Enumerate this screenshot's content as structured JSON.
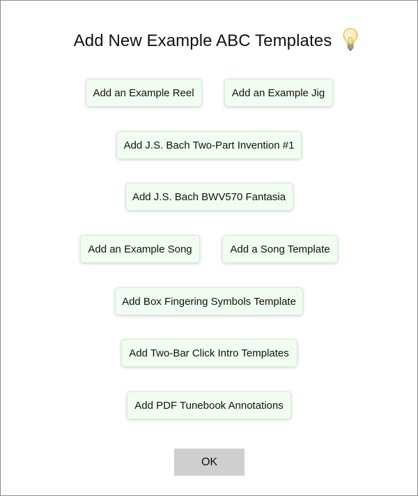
{
  "dialog": {
    "title": "Add New Example ABC Templates",
    "hint_icon": "lightbulb-icon"
  },
  "buttons": {
    "reel": "Add an Example Reel",
    "jig": "Add an Example Jig",
    "bach_invention": "Add J.S. Bach Two-Part Invention #1",
    "bach_fantasia": "Add J.S. Bach BWV570 Fantasia",
    "song": "Add an Example Song",
    "song_template": "Add a Song Template",
    "box_fingering": "Add Box Fingering Symbols Template",
    "click_intro": "Add Two-Bar Click Intro Templates",
    "pdf_annotations": "Add PDF Tunebook Annotations",
    "ok": "OK"
  },
  "colors": {
    "button_bg": "#f1fdf1",
    "ok_bg": "#cfcfcf"
  }
}
